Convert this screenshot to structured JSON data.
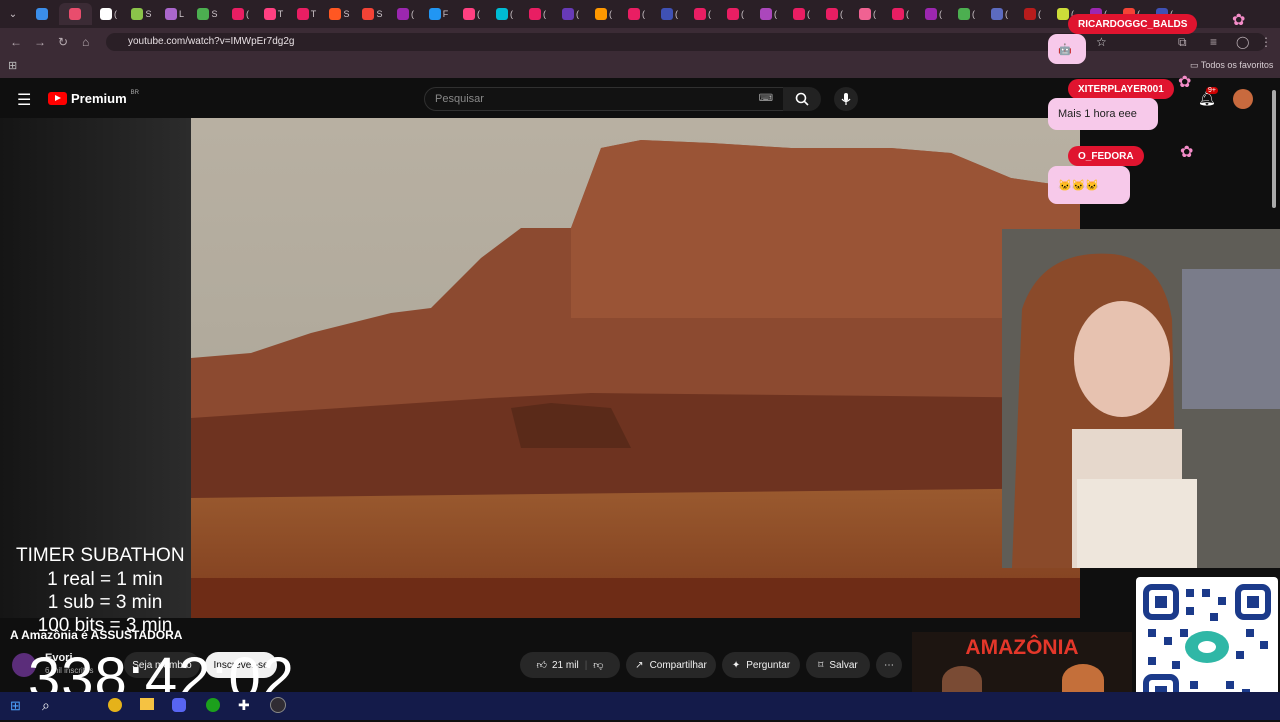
{
  "browser": {
    "url": "youtube.com/watch?v=IMWpEr7dg2g",
    "bookmarks_label": "Todos os favoritos",
    "tab_letters": [
      "",
      "",
      "(",
      "S",
      "L",
      "S",
      "(",
      "T",
      "T",
      "S",
      "S",
      "(",
      "F",
      "(",
      "(",
      "(",
      "(",
      "(",
      "(",
      "(",
      "(",
      "(",
      "(",
      "(",
      "(",
      "(",
      "(",
      "(",
      "(",
      "(",
      "(",
      "(",
      "(",
      "(",
      "("
    ]
  },
  "youtube": {
    "logo_text": "Premium",
    "region": "BR",
    "search_placeholder": "Pesquisar",
    "notification_count": "9+"
  },
  "video": {
    "title": "A Amazônia é ASSUSTADORA",
    "channel": "Evori",
    "subscribers": "6 mil inscritos",
    "join_label": "Seja membro",
    "subscribe_label": "Inscrever-se",
    "likes": "21 mil",
    "share_label": "Compartilhar",
    "ask_label": "Perguntar",
    "save_label": "Salvar",
    "thumbnail_title": "AMAZÔNIA"
  },
  "overlay": {
    "timer_title": "TIMER SUBATHON",
    "timer_lines": [
      "1 real = 1 min",
      "1 sub = 3 min",
      "100 bits = 3 min"
    ],
    "timer_count": "338:42:02"
  },
  "chat": [
    {
      "name": "RICARDOGGC_BALDS",
      "msg": ""
    },
    {
      "name": "XITERPLAYER001",
      "msg": "Mais 1 hora eee"
    },
    {
      "name": "O_FEDORA",
      "msg": ""
    }
  ],
  "colors": {
    "yt_red": "#ff0000",
    "chat_name_bg": "#e0142f",
    "chat_msg_bg": "#f7c9ea",
    "taskbar": "#141b4a"
  }
}
